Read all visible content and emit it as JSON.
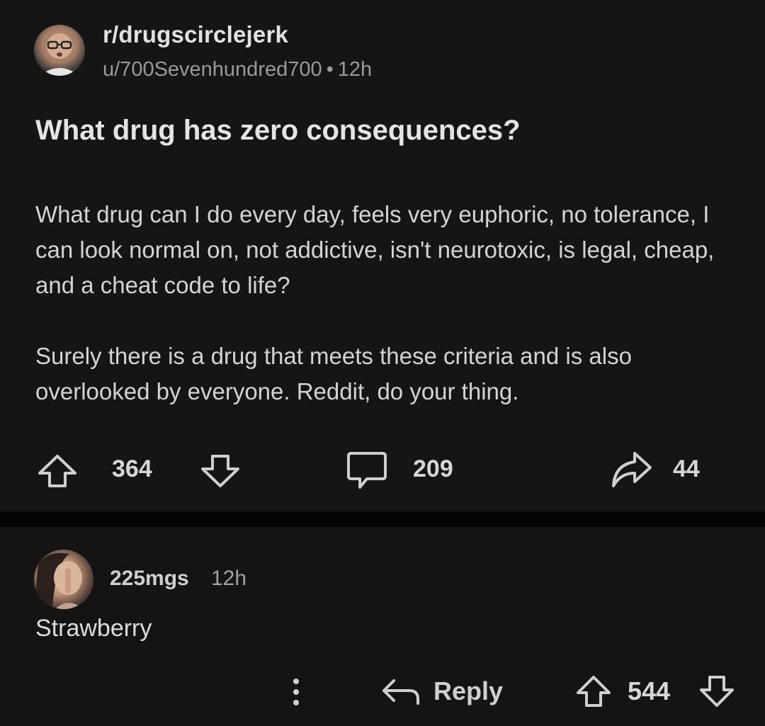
{
  "post": {
    "subreddit": "r/drugscirclejerk",
    "username": "u/700Sevenhundred700",
    "separator": "•",
    "age": "12h",
    "title": "What drug has zero consequences?",
    "paragraphs": [
      "What drug can I do every day, feels very euphoric, no tolerance, I can look normal on, not addictive, isn't neurotoxic, is legal, cheap, and a cheat code to life?",
      "Surely there is a drug that meets these criteria and is also overlooked by everyone. Reddit, do your thing."
    ],
    "actions": {
      "upvote_icon": "arrow-up-icon",
      "votes": "364",
      "downvote_icon": "arrow-down-icon",
      "comment_icon": "speech-bubble-icon",
      "comments": "209",
      "share_icon": "share-arrow-icon",
      "shares": "44"
    }
  },
  "comment": {
    "author": "225mgs",
    "age": "12h",
    "text": "Strawberry",
    "actions": {
      "more_icon": "vertical-dots-icon",
      "reply_icon": "reply-arrow-icon",
      "reply_label": "Reply",
      "upvote_icon": "arrow-up-icon",
      "votes": "544",
      "downvote_icon": "arrow-down-icon"
    }
  },
  "colors": {
    "background": "#151515",
    "divider": "#050505",
    "text_primary": "#e2e2e2",
    "text_secondary": "#9a9a9a"
  }
}
